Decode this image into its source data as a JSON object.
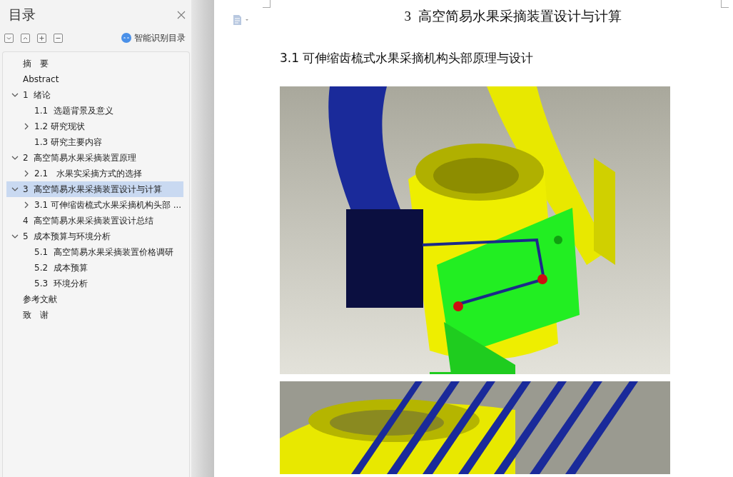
{
  "sidebar": {
    "title": "目录",
    "tools": [
      {
        "kind": "expand"
      },
      {
        "kind": "collapse"
      },
      {
        "kind": "plus"
      },
      {
        "kind": "minus"
      }
    ],
    "smart_button": "智能识别目录",
    "items": [
      {
        "label": "摘　要",
        "selected": false
      },
      {
        "label": "Abstract",
        "selected": false
      },
      {
        "label": "1  绪论",
        "selected": false,
        "expanded": true,
        "children": [
          {
            "label": "1.1  选题背景及意义",
            "selected": false
          },
          {
            "label": "1.2 研究现状",
            "selected": false,
            "expanded": false
          },
          {
            "label": "1.3 研究主要内容",
            "selected": false
          }
        ]
      },
      {
        "label": "2  高空简易水果采摘装置原理",
        "selected": false,
        "expanded": true,
        "children": [
          {
            "label": "2.1　水果实采摘方式的选择",
            "selected": false,
            "expanded": false
          }
        ]
      },
      {
        "label": "3  高空简易水果采摘装置设计与计算",
        "selected": true,
        "expanded": true,
        "children": [
          {
            "label": "3.1 可伸缩齿梳式水果采摘机构头部 ...",
            "selected": false,
            "expanded": false
          }
        ]
      },
      {
        "label": "4  高空简易水果采摘装置设计总结",
        "selected": false
      },
      {
        "label": "5  成本预算与环境分析",
        "selected": false,
        "expanded": true,
        "children": [
          {
            "label": "5.1  高空简易水果采摘装置价格调研",
            "selected": false
          },
          {
            "label": "5.2  成本预算",
            "selected": false
          },
          {
            "label": "5.3  环境分析",
            "selected": false
          }
        ]
      },
      {
        "label": "参考文献",
        "selected": false
      },
      {
        "label": "致　谢",
        "selected": false
      }
    ]
  },
  "document": {
    "chapter_title": "3  高空简易水果采摘装置设计与计算",
    "section_heading": "3.1 可伸缩齿梳式水果采摘机构头部原理与设计"
  }
}
